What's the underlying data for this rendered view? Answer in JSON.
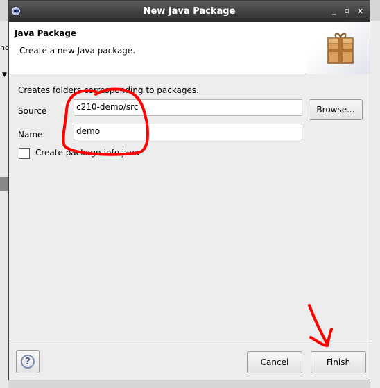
{
  "background": {
    "left_fragment": "nd"
  },
  "window": {
    "title": "New Java Package",
    "controls": "_ ▫ x"
  },
  "header": {
    "title": "Java Package",
    "description": "Create a new Java package."
  },
  "form": {
    "info": "Creates folders corresponding to packages.",
    "source_label": "Source",
    "source_value": "c210-demo/src",
    "browse_label": "Browse...",
    "name_label": "Name:",
    "name_value": "demo",
    "checkbox_label": "Create package-info.java",
    "checkbox_checked": false
  },
  "footer": {
    "help_symbol": "?",
    "cancel_label": "Cancel",
    "finish_label": "Finish"
  },
  "icons": {
    "app": "eclipse-icon",
    "banner": "package-icon",
    "help": "help-icon"
  },
  "colors": {
    "titlebar": "#2d2d2d",
    "annotation": "#ff0000"
  }
}
